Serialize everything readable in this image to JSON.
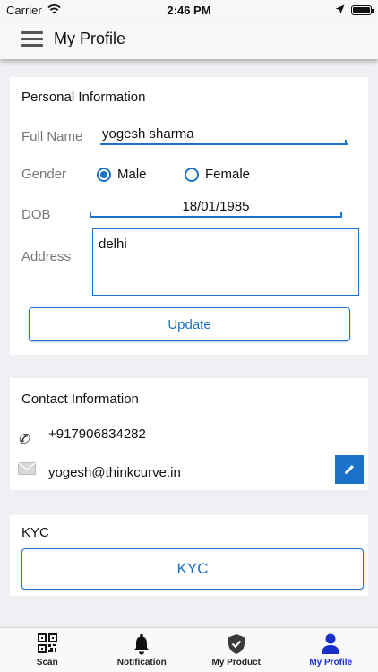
{
  "status_bar": {
    "carrier": "Carrier",
    "time": "2:46 PM"
  },
  "nav": {
    "title": "My Profile"
  },
  "personal": {
    "title": "Personal Information",
    "full_name_label": "Full Name",
    "full_name_value": "yogesh sharma",
    "gender_label": "Gender",
    "gender_options": [
      "Male",
      "Female"
    ],
    "gender_selected": "Male",
    "dob_label": "DOB",
    "dob_value": "18/01/1985",
    "address_label": "Address",
    "address_value": "delhi",
    "update_label": "Update"
  },
  "contact": {
    "title": "Contact Information",
    "phone": "+917906834282",
    "email": "yogesh@thinkcurve.in"
  },
  "kyc": {
    "title": "KYC",
    "button_label": "KYC"
  },
  "tabs": [
    {
      "label": "Scan",
      "icon": "qr-code-icon",
      "active": false
    },
    {
      "label": "Notification",
      "icon": "bell-icon",
      "active": false
    },
    {
      "label": "My Product",
      "icon": "shield-check-icon",
      "active": false
    },
    {
      "label": "My Profile",
      "icon": "person-icon",
      "active": true
    }
  ],
  "colors": {
    "accent": "#1a73c8",
    "active_tab": "#1a2fc8",
    "background": "#efeff4"
  }
}
